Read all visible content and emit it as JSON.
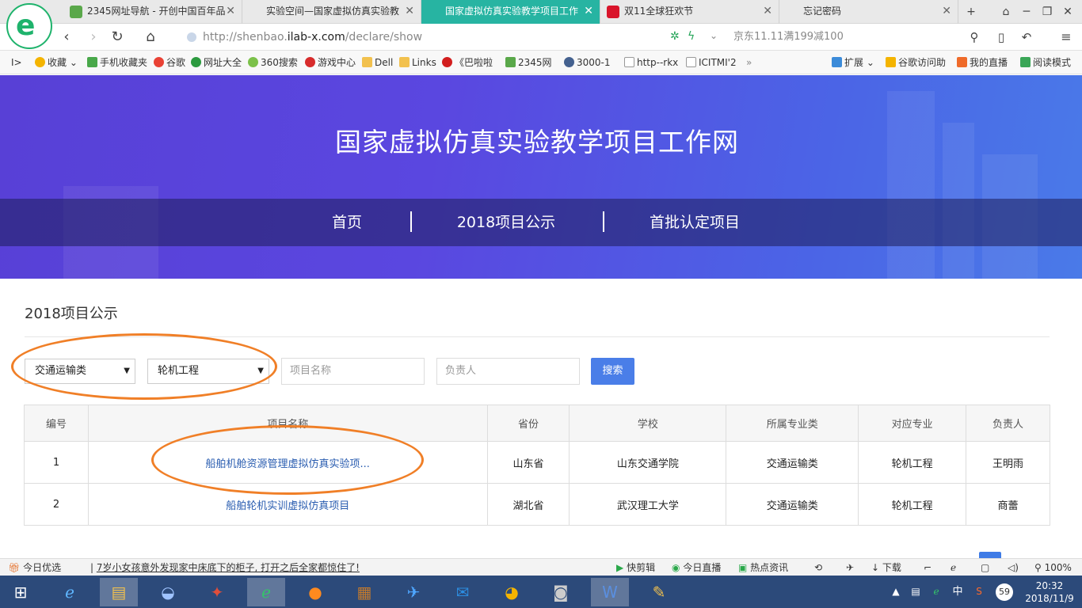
{
  "browser": {
    "tabs": [
      {
        "label": "2345网址导航 - 开创中国百年品",
        "active": false
      },
      {
        "label": "实验空间—国家虚拟仿真实验教",
        "active": false
      },
      {
        "label": "国家虚拟仿真实验教学项目工作",
        "active": true
      },
      {
        "label": "双11全球狂欢节",
        "active": false
      },
      {
        "label": "忘记密码",
        "active": false
      }
    ],
    "url_prefix": "http://shenbao.",
    "url_host": "ilab-x.com",
    "url_path": "/declare/show",
    "promo_text": "京东11.11满199减100",
    "bookmarks": [
      "收藏",
      "手机收藏夹",
      "谷歌",
      "网址大全",
      "360搜索",
      "游戏中心",
      "Dell",
      "Links",
      "《巴啦啦",
      "2345网",
      "3000-1",
      "http--rkx",
      "ICITMI'2",
      "»"
    ],
    "bookmarks_right": [
      "扩展",
      "谷歌访问助",
      "我的直播",
      "阅读模式"
    ]
  },
  "site": {
    "title": "国家虚拟仿真实验教学项目工作网",
    "nav": [
      "首页",
      "2018项目公示",
      "首批认定项目"
    ]
  },
  "section_title": "2018项目公示",
  "filters": {
    "category": "交通运输类",
    "major": "轮机工程",
    "project_name_placeholder": "项目名称",
    "owner_placeholder": "负责人",
    "search_label": "搜索"
  },
  "table": {
    "headers": [
      "编号",
      "项目名称",
      "省份",
      "学校",
      "所属专业类",
      "对应专业",
      "负责人"
    ],
    "rows": [
      [
        "1",
        "船舶机舱资源管理虚拟仿真实验项...",
        "山东省",
        "山东交通学院",
        "交通运输类",
        "轮机工程",
        "王明雨"
      ],
      [
        "2",
        "船舶轮机实训虚拟仿真项目",
        "湖北省",
        "武汉理工大学",
        "交通运输类",
        "轮机工程",
        "商蕾"
      ]
    ]
  },
  "statusbar": {
    "today_label": "今日优选",
    "news": "7岁小女孩意外发现家中床底下的柜子, 打开之后全家都惊住了!",
    "items": [
      "快剪辑",
      "今日直播",
      "热点资讯",
      "下载"
    ],
    "zoom": "100%"
  },
  "taskbar": {
    "ime": "中",
    "badge": "59",
    "time": "20:32",
    "date": "2018/11/9"
  },
  "colors": {
    "active_tab": "#27b4a2",
    "banner": "#5a47e0",
    "search_button": "#4a7ee8",
    "link": "#2a5db0",
    "annotation_circle": "#f07f27"
  }
}
